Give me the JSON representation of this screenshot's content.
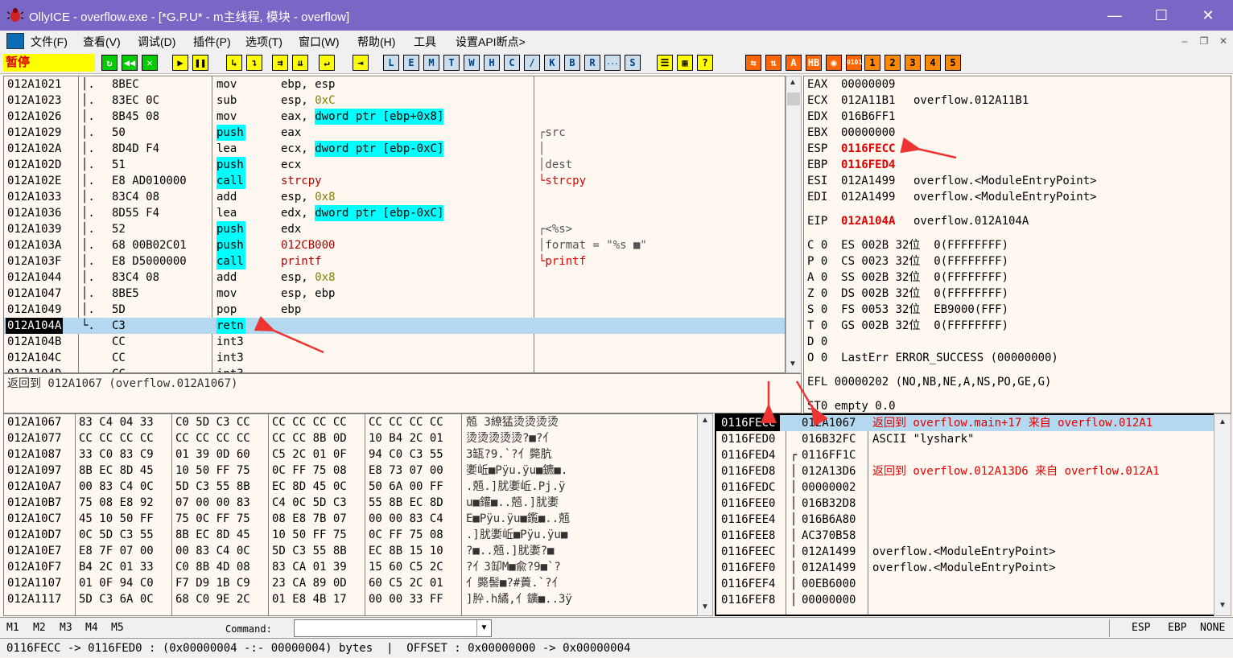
{
  "window": {
    "title": "OllyICE - overflow.exe - [*G.P.U* - m主线程, 模块 - overflow]",
    "minimize": "—",
    "maximize": "☐",
    "close": "✕"
  },
  "menu": [
    "文件(F)",
    "查看(V)",
    "调试(D)",
    "插件(P)",
    "选项(T)",
    "窗口(W)",
    "帮助(H)",
    "工具",
    "设置API断点>"
  ],
  "status": "暂停",
  "toolbar": {
    "group1": [
      "↻",
      "◀◀",
      "✕"
    ],
    "group2": [
      "▶",
      "❚❚"
    ],
    "group3": [
      "↳",
      "↴"
    ],
    "group4": [
      "⇉",
      "⇊"
    ],
    "group5": [
      "↵"
    ],
    "group6": [
      "⇥"
    ],
    "letters": [
      "L",
      "E",
      "M",
      "T",
      "W",
      "H",
      "C",
      "/",
      "K",
      "B",
      "R",
      "...",
      "S"
    ],
    "group8": [
      "☰",
      "▦",
      "?"
    ],
    "group9": [
      "⇆",
      "⇅",
      "A",
      "HB",
      "◉",
      "0101"
    ],
    "numbers": [
      "1",
      "2",
      "3",
      "4",
      "5"
    ]
  },
  "disasm": {
    "rows": [
      {
        "addr": "012A1021",
        "tree": "│.",
        "hex": "8BEC",
        "mn": "mov",
        "ops": [
          "ebp, esp"
        ],
        "cmt": ""
      },
      {
        "addr": "012A1023",
        "tree": "│.",
        "hex": "83EC 0C",
        "mn": "sub",
        "ops": [
          "esp, ",
          "0xC"
        ],
        "cmt": ""
      },
      {
        "addr": "012A1026",
        "tree": "│.",
        "hex": "8B45 08",
        "mn": "mov",
        "ops": [
          "eax, ",
          "dword ptr [ebp+0x8]"
        ],
        "cmt": ""
      },
      {
        "addr": "012A1029",
        "tree": "│.",
        "hex": "50",
        "mn": "push",
        "ops": [
          "eax"
        ],
        "cmt": "┌src"
      },
      {
        "addr": "012A102A",
        "tree": "│.",
        "hex": "8D4D F4",
        "mn": "lea",
        "ops": [
          "ecx, ",
          "dword ptr [ebp-0xC]"
        ],
        "cmt": "│"
      },
      {
        "addr": "012A102D",
        "tree": "│.",
        "hex": "51",
        "mn": "push",
        "ops": [
          "ecx"
        ],
        "cmt": "│dest"
      },
      {
        "addr": "012A102E",
        "tree": "│.",
        "hex": "E8 AD010000",
        "mn": "call",
        "ops": [
          "strcpy"
        ],
        "cmt": "└strcpy"
      },
      {
        "addr": "012A1033",
        "tree": "│.",
        "hex": "83C4 08",
        "mn": "add",
        "ops": [
          "esp, ",
          "0x8"
        ],
        "cmt": ""
      },
      {
        "addr": "012A1036",
        "tree": "│.",
        "hex": "8D55 F4",
        "mn": "lea",
        "ops": [
          "edx, ",
          "dword ptr [ebp-0xC]"
        ],
        "cmt": ""
      },
      {
        "addr": "012A1039",
        "tree": "│.",
        "hex": "52",
        "mn": "push",
        "ops": [
          "edx"
        ],
        "cmt": "┌<%s>"
      },
      {
        "addr": "012A103A",
        "tree": "│.",
        "hex": "68 00B02C01",
        "mn": "push",
        "ops": [
          "012CB000"
        ],
        "cmt": "│format = \"%s ■\""
      },
      {
        "addr": "012A103F",
        "tree": "│.",
        "hex": "E8 D5000000",
        "mn": "call",
        "ops": [
          "printf"
        ],
        "cmt": "└printf"
      },
      {
        "addr": "012A1044",
        "tree": "│.",
        "hex": "83C4 08",
        "mn": "add",
        "ops": [
          "esp, ",
          "0x8"
        ],
        "cmt": ""
      },
      {
        "addr": "012A1047",
        "tree": "│.",
        "hex": "8BE5",
        "mn": "mov",
        "ops": [
          "esp, ebp"
        ],
        "cmt": ""
      },
      {
        "addr": "012A1049",
        "tree": "│.",
        "hex": "5D",
        "mn": "pop",
        "ops": [
          "ebp"
        ],
        "cmt": ""
      },
      {
        "addr": "012A104A",
        "tree": "└.",
        "hex": "C3",
        "mn": "retn",
        "ops": [
          ""
        ],
        "cmt": ""
      },
      {
        "addr": "012A104B",
        "tree": "",
        "hex": "CC",
        "mn": "int3",
        "ops": [
          ""
        ],
        "cmt": ""
      },
      {
        "addr": "012A104C",
        "tree": "",
        "hex": "CC",
        "mn": "int3",
        "ops": [
          ""
        ],
        "cmt": ""
      },
      {
        "addr": "012A104D",
        "tree": "",
        "hex": "CC",
        "mn": "int3",
        "ops": [
          ""
        ],
        "cmt": ""
      }
    ],
    "info": "返回到 012A1067 (overflow.012A1067)"
  },
  "registers": {
    "gp": [
      {
        "name": "EAX",
        "val": "00000009",
        "cmt": ""
      },
      {
        "name": "ECX",
        "val": "012A11B1",
        "cmt": "overflow.012A11B1"
      },
      {
        "name": "EDX",
        "val": "016B6FF1",
        "cmt": ""
      },
      {
        "name": "EBX",
        "val": "00000000",
        "cmt": ""
      },
      {
        "name": "ESP",
        "val": "0116FECC",
        "cmt": "",
        "red": true
      },
      {
        "name": "EBP",
        "val": "0116FED4",
        "cmt": "",
        "red": true
      },
      {
        "name": "ESI",
        "val": "012A1499",
        "cmt": "overflow.<ModuleEntryPoint>"
      },
      {
        "name": "EDI",
        "val": "012A1499",
        "cmt": "overflow.<ModuleEntryPoint>"
      }
    ],
    "eip": {
      "name": "EIP",
      "val": "012A104A",
      "cmt": "overflow.012A104A"
    },
    "flags": [
      "C 0  ES 002B 32位  0(FFFFFFFF)",
      "P 0  CS 0023 32位  0(FFFFFFFF)",
      "A 0  SS 002B 32位  0(FFFFFFFF)",
      "Z 0  DS 002B 32位  0(FFFFFFFF)",
      "S 0  FS 0053 32位  EB9000(FFF)",
      "T 0  GS 002B 32位  0(FFFFFFFF)",
      "D 0",
      "O 0  LastErr ERROR_SUCCESS (00000000)"
    ],
    "efl": "EFL 00000202 (NO,NB,NE,A,NS,PO,GE,G)",
    "st0": "ST0 empty 0.0"
  },
  "dump": {
    "rows": [
      {
        "addr": "012A1067",
        "hex": [
          "83 C4 04 33",
          "C0 5D C3 CC",
          "CC CC CC CC",
          "CC CC CC CC"
        ],
        "ascii": "兡 3繚猛烫烫烫烫"
      },
      {
        "addr": "012A1077",
        "hex": [
          "CC CC CC CC",
          "CC CC CC CC",
          "CC CC 8B 0D",
          "10 B4 2C 01"
        ],
        "ascii": "烫烫烫烫烫?■?亻"
      },
      {
        "addr": "012A1087",
        "hex": [
          "33 C0 83 C9",
          "01 39 0D 60",
          "C5 2C 01 0F",
          "94 C0 C3 55"
        ],
        "ascii": "3缻?9.`?亻斃肮"
      },
      {
        "addr": "012A1097",
        "hex": [
          "8B EC 8D 45",
          "10 50 FF 75",
          "0C FF 75 08",
          "E8 73 07 00"
        ],
        "ascii": "嬱岴■Pÿu.ÿu■鑣■."
      },
      {
        "addr": "012A10A7",
        "hex": [
          "00 83 C4 0C",
          "5D C3 55 8B",
          "EC 8D 45 0C",
          "50 6A 00 FF"
        ],
        "ascii": ".兡.]肬嬱岴.Pj.ÿ"
      },
      {
        "addr": "012A10B7",
        "hex": [
          "75 08 E8 92",
          "07 00 00 83",
          "C4 0C 5D C3",
          "55 8B EC 8D"
        ],
        "ascii": "u■鑵■..兡.]肬嬱"
      },
      {
        "addr": "012A10C7",
        "hex": [
          "45 10 50 FF",
          "75 0C FF 75",
          "08 E8 7B 07",
          "00 00 83 C4"
        ],
        "ascii": "E■Pÿu.ÿu■鑬■..兡"
      },
      {
        "addr": "012A10D7",
        "hex": [
          "0C 5D C3 55",
          "8B EC 8D 45",
          "10 50 FF 75",
          "0C FF 75 08"
        ],
        "ascii": ".]肬嬱岴■Pÿu.ÿu■"
      },
      {
        "addr": "012A10E7",
        "hex": [
          "E8 7F 07 00",
          "00 83 C4 0C",
          "5D C3 55 8B",
          "EC 8B 15 10"
        ],
        "ascii": "?■..兡.]肬嬱?■"
      },
      {
        "addr": "012A10F7",
        "hex": [
          "B4 2C 01 33",
          "C0 8B 4D 08",
          "83 CA 01 39",
          "15 60 C5 2C"
        ],
        "ascii": "?亻3缷M■兪?9■`?"
      },
      {
        "addr": "012A1107",
        "hex": [
          "01 0F 94 C0",
          "F7 D9 1B C9",
          "23 CA 89 0D",
          "60 C5 2C 01"
        ],
        "ascii": "亻斃髻■?#蕢.`?亻"
      },
      {
        "addr": "012A1117",
        "hex": [
          "5D C3 6A 0C",
          "68 C0 9E 2C",
          "01 E8 4B 17",
          "00 00 33 FF"
        ],
        "ascii": "]肸.h繘,亻鑛■..3ÿ"
      }
    ]
  },
  "stack": {
    "rows": [
      {
        "addr": "0116FECC",
        "tree": "",
        "val": "012A1067",
        "cmt": "返回到 overflow.main+17 来自 overflow.012A1",
        "red": true,
        "sel": true
      },
      {
        "addr": "0116FED0",
        "tree": "",
        "val": "016B32FC",
        "cmt": "ASCII \"lyshark\"",
        "red": false
      },
      {
        "addr": "0116FED4",
        "tree": "┌",
        "val": "0116FF1C",
        "cmt": "",
        "red": false
      },
      {
        "addr": "0116FED8",
        "tree": "│",
        "val": "012A13D6",
        "cmt": "返回到 overflow.012A13D6 来自 overflow.012A1",
        "red": true
      },
      {
        "addr": "0116FEDC",
        "tree": "│",
        "val": "00000002",
        "cmt": "",
        "red": false
      },
      {
        "addr": "0116FEE0",
        "tree": "│",
        "val": "016B32D8",
        "cmt": "",
        "red": false
      },
      {
        "addr": "0116FEE4",
        "tree": "│",
        "val": "016B6A80",
        "cmt": "",
        "red": false
      },
      {
        "addr": "0116FEE8",
        "tree": "│",
        "val": "AC370B58",
        "cmt": "",
        "red": false
      },
      {
        "addr": "0116FEEC",
        "tree": "│",
        "val": "012A1499",
        "cmt": "overflow.<ModuleEntryPoint>",
        "red": false
      },
      {
        "addr": "0116FEF0",
        "tree": "│",
        "val": "012A1499",
        "cmt": "overflow.<ModuleEntryPoint>",
        "red": false
      },
      {
        "addr": "0116FEF4",
        "tree": "│",
        "val": "00EB6000",
        "cmt": "",
        "red": false
      },
      {
        "addr": "0116FEF8",
        "tree": "│",
        "val": "00000000",
        "cmt": "",
        "red": false
      }
    ]
  },
  "command": {
    "tabs": [
      "M1",
      "M2",
      "M3",
      "M4",
      "M5"
    ],
    "label": "Command:",
    "value": "",
    "right": [
      "ESP",
      "EBP",
      "NONE"
    ]
  },
  "statusline": "0116FECC -> 0116FED0 : (0x00000004 -:- 00000004) bytes  |  OFFSET : 0x00000000 -> 0x00000004",
  "colors": {
    "titlebar": "#7A67C5",
    "panel": "#FFF8F0",
    "highlight": "#00FFFF",
    "red": "#E00000",
    "selection": "#B4D8F0"
  }
}
